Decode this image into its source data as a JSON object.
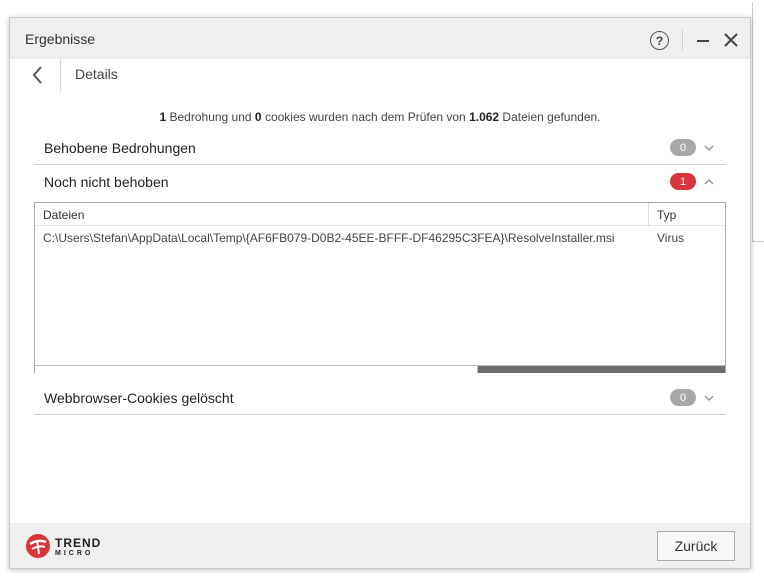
{
  "window": {
    "title": "Ergebnisse",
    "help_label": "?"
  },
  "nav": {
    "page_title": "Details"
  },
  "summary": {
    "threats_count": "1",
    "text_a": " Bedrohung und ",
    "cookies_count": "0",
    "text_b": " cookies wurden nach dem Prüfen von ",
    "files_count": "1.062",
    "text_c": " Dateien gefunden."
  },
  "sections": [
    {
      "label": "Behobene Bedrohungen",
      "count": "0",
      "badge_color": "#a8a8a8",
      "expanded": false
    },
    {
      "label": "Noch nicht behoben",
      "count": "1",
      "badge_color": "#d9343c",
      "expanded": true
    },
    {
      "label": "Webbrowser-Cookies gelöscht",
      "count": "0",
      "badge_color": "#a8a8a8",
      "expanded": false
    }
  ],
  "table": {
    "columns": [
      "Dateien",
      "Typ"
    ],
    "rows": [
      {
        "file": "C:\\Users\\Stefan\\AppData\\Local\\Temp\\{AF6FB079-D0B2-45EE-BFFF-DF46295C3FEA}\\ResolveInstaller.msi",
        "type": "Virus"
      }
    ],
    "scroll_position": 0.64
  },
  "footer": {
    "logo_text": "TREND",
    "logo_sub": "MICRO",
    "back_button_label": "Zurück"
  },
  "colors": {
    "brand_red": "#d9343c",
    "badge_gray": "#a8a8a8",
    "titlebar_bg": "#efefef"
  },
  "icons": [
    "help-icon",
    "minimize-icon",
    "close-icon",
    "back-arrow-icon",
    "chevron-down-icon",
    "chevron-up-icon",
    "trend-micro-logo"
  ]
}
